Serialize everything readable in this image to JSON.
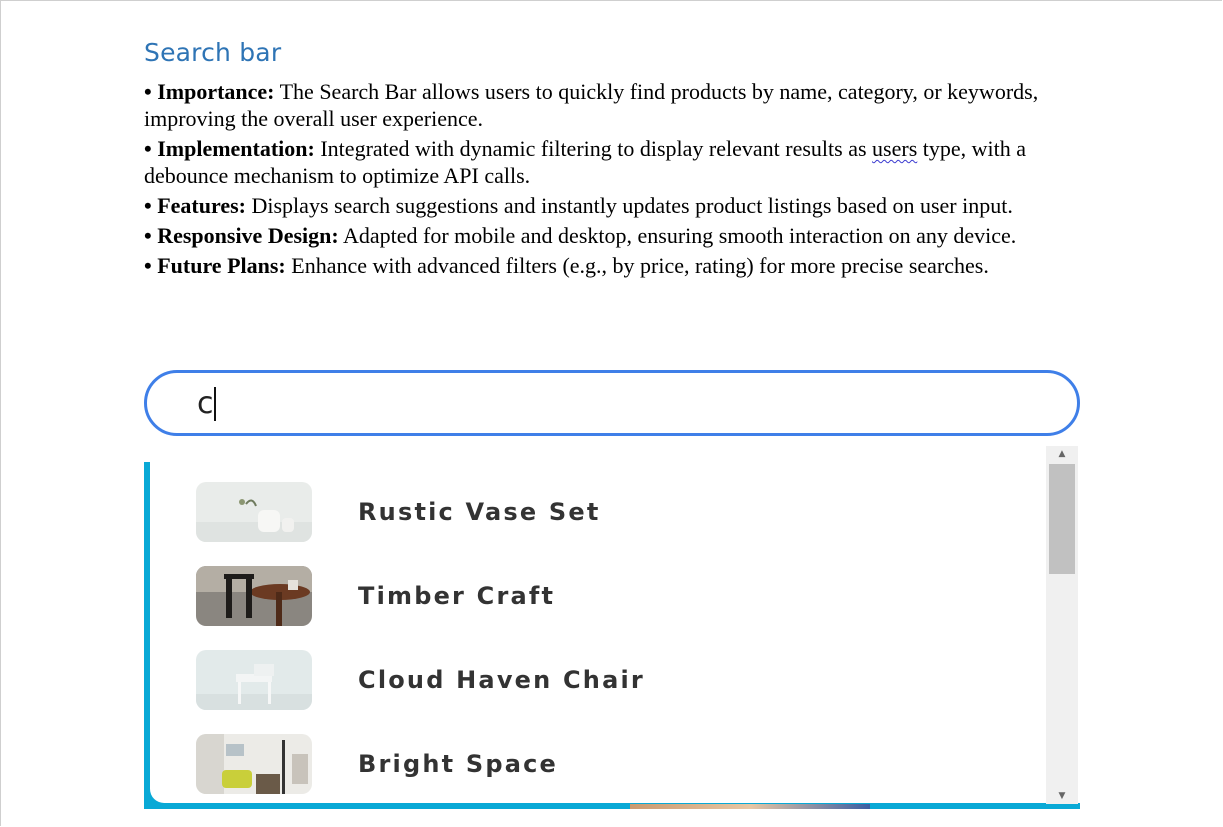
{
  "section": {
    "heading": "Search bar"
  },
  "bullets": [
    {
      "mark": "•",
      "term": "Importance:",
      "text_before": " The Search Bar allows users to quickly find products by name, category, or keywords, improving the overall user experience.",
      "squiggle": "",
      "text_after": ""
    },
    {
      "mark": "•",
      "term": "Implementation:",
      "text_before": " Integrated with dynamic filtering to display relevant results as ",
      "squiggle": "users",
      "text_after": " type, with a debounce mechanism to optimize API calls."
    },
    {
      "mark": "•",
      "term": "Features:",
      "text_before": " Displays search suggestions and instantly updates product listings based on user input.",
      "squiggle": "",
      "text_after": ""
    },
    {
      "mark": "•",
      "term": "Responsive Design:",
      "text_before": " Adapted for mobile and desktop, ensuring smooth interaction on any device.",
      "squiggle": "",
      "text_after": ""
    },
    {
      "mark": "•",
      "term": "Future Plans:",
      "text_before": " Enhance with advanced filters (e.g., by price, rating) for more precise searches.",
      "squiggle": "",
      "text_after": ""
    }
  ],
  "search": {
    "value": "c"
  },
  "results": [
    {
      "label": "Rustic Vase Set",
      "thumb": "vase-thumbnail"
    },
    {
      "label": "Timber Craft",
      "thumb": "chair-table-thumbnail"
    },
    {
      "label": "Cloud Haven Chair",
      "thumb": "white-chair-thumbnail"
    },
    {
      "label": "Bright Space",
      "thumb": "room-thumbnail"
    }
  ],
  "scrollbar": {
    "up_glyph": "▲",
    "down_glyph": "▼",
    "scroll_fraction": 0.0
  },
  "colors": {
    "heading": "#2e74b5",
    "search_border": "#3f7fe8",
    "results_accent": "#09a9d6"
  }
}
